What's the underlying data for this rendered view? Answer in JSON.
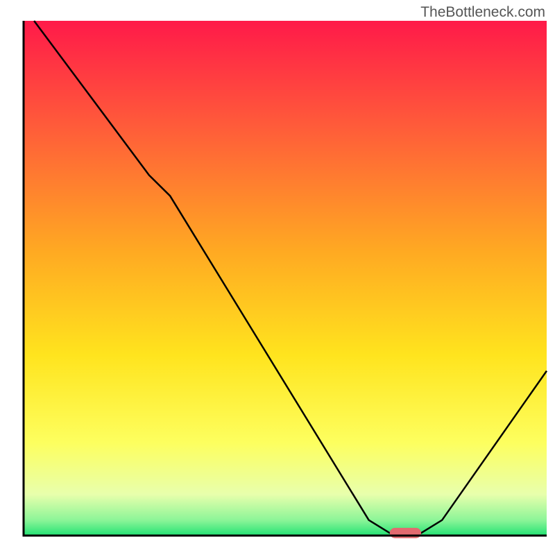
{
  "watermark": "TheBottleneck.com",
  "chart_data": {
    "type": "line",
    "title": "",
    "xlabel": "",
    "ylabel": "",
    "xlim": [
      0,
      100
    ],
    "ylim": [
      0,
      100
    ],
    "gradient_stops": [
      {
        "offset": 0.0,
        "color": "#ff1a49"
      },
      {
        "offset": 0.2,
        "color": "#ff5a3a"
      },
      {
        "offset": 0.45,
        "color": "#ffaa22"
      },
      {
        "offset": 0.65,
        "color": "#ffe41e"
      },
      {
        "offset": 0.82,
        "color": "#fdff5f"
      },
      {
        "offset": 0.92,
        "color": "#e8ffac"
      },
      {
        "offset": 0.97,
        "color": "#8cf598"
      },
      {
        "offset": 1.0,
        "color": "#23e274"
      }
    ],
    "axis_color": "#000000",
    "axis_width": 3,
    "curve": {
      "points": [
        {
          "x": 2,
          "y": 100
        },
        {
          "x": 24,
          "y": 70
        },
        {
          "x": 28,
          "y": 66
        },
        {
          "x": 66,
          "y": 3
        },
        {
          "x": 70,
          "y": 0.5
        },
        {
          "x": 76,
          "y": 0.5
        },
        {
          "x": 80,
          "y": 3
        },
        {
          "x": 100,
          "y": 32
        }
      ],
      "stroke": "#000000",
      "width": 2.5
    },
    "marker": {
      "x": 73,
      "y": 0.5,
      "width": 6,
      "height": 2,
      "rx": 1,
      "color": "#e36a6f"
    }
  }
}
